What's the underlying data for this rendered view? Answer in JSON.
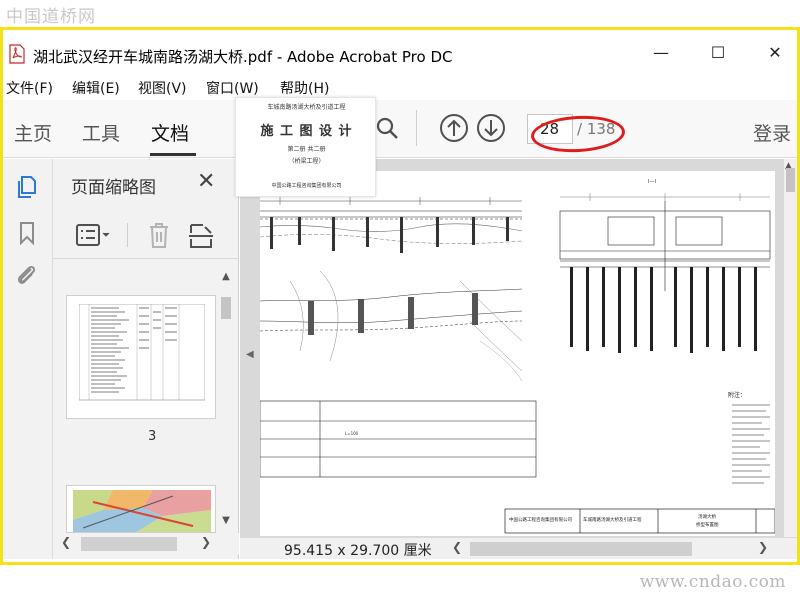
{
  "watermark": {
    "top": "中国道桥网",
    "bottom": "www.cndao.com"
  },
  "window": {
    "title": "湖北武汉经开车城南路汤湖大桥.pdf - Adobe Acrobat Pro DC",
    "minimize": "—",
    "maximize": "☐",
    "close": "✕"
  },
  "menu": {
    "items": [
      {
        "label": "文件(F)"
      },
      {
        "label": "编辑(E)"
      },
      {
        "label": "视图(V)"
      },
      {
        "label": "窗口(W)"
      },
      {
        "label": "帮助(H)"
      }
    ]
  },
  "toolbar": {
    "tabs": [
      {
        "label": "主页"
      },
      {
        "label": "工具"
      },
      {
        "label": "文档"
      }
    ],
    "current_page": "28",
    "total_pages": "/ 138",
    "login": "登录"
  },
  "panel": {
    "title": "页面缩略图",
    "thumbnail_label": "3"
  },
  "status": {
    "page_size": "95.415 x 29.700 厘米"
  },
  "popup": {
    "line1": "车城南路汤湖大桥及引道工程",
    "line2": "施 工 图 设 计",
    "line3": "第二册  共二册",
    "line4": "（桥梁工程）",
    "line5": "中国公路工程咨询集团有限公司"
  },
  "drawing": {
    "company": "中国公路工程咨询集团有限公司",
    "project": "车城南路汤湖大桥及引道工程",
    "sheet_title": "汤湖大桥",
    "sheet_subtitle": "桥型布置图",
    "notes_title": "附注：",
    "section_label": "Ⅰ—Ⅰ"
  },
  "colors": {
    "highlight_border": "#f2e21a",
    "annotation_ellipse": "#e01b1b",
    "icon_blue": "#2d7ad6"
  }
}
